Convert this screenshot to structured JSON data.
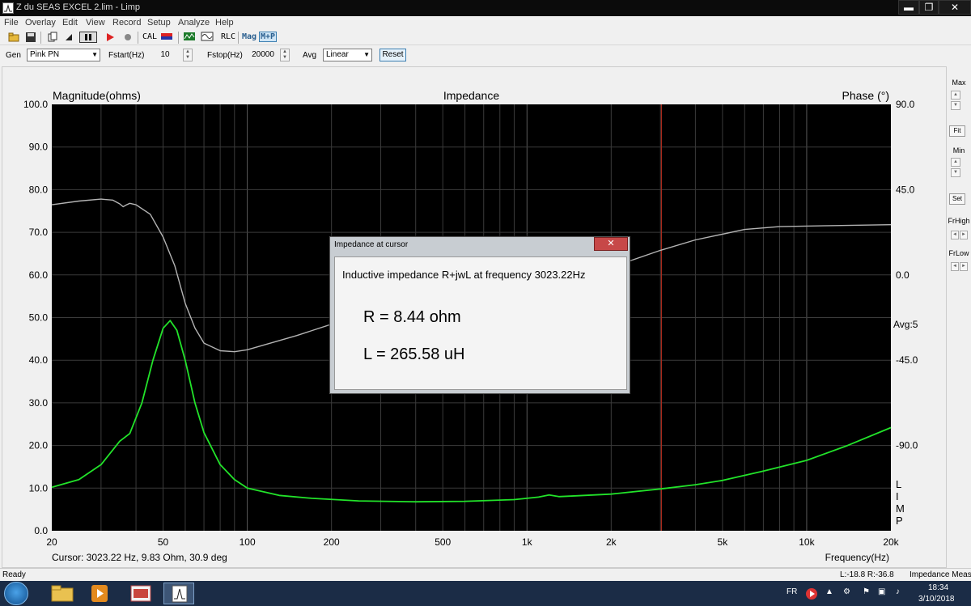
{
  "window": {
    "title": "Z du SEAS EXCEL 2.lim - Limp",
    "min_glyph": "▬",
    "max_glyph": "❐",
    "close_glyph": "✕"
  },
  "menu": [
    "File",
    "Overlay",
    "Edit",
    "View",
    "Record",
    "Setup",
    "Analyze",
    "Help"
  ],
  "toolbar": {
    "cal_label": "CAL",
    "rlc_label": "RLC",
    "mag_label": "Mag",
    "mp_label": "M+P",
    "icons": [
      "open-file-icon",
      "save-icon",
      "copy-icon",
      "play-single-icon",
      "pause-icon",
      "play-icon",
      "record-icon",
      "calibrate-icon",
      "signal-icon",
      "rlc-icon"
    ]
  },
  "controls": {
    "gen_label": "Gen",
    "gen_value": "Pink PN",
    "fstart_label": "Fstart(Hz)",
    "fstart_value": "10",
    "fstop_label": "Fstop(Hz)",
    "fstop_value": "20000",
    "avg_label": "Avg",
    "avg_value": "Linear",
    "reset_label": "Reset"
  },
  "chart_data": {
    "type": "line",
    "title": "Impedance",
    "ylabel_left": "Magnitude(ohms)",
    "ylabel_right": "Phase (°)",
    "xlabel": "Frequency(Hz)",
    "x_scale": "log",
    "xlim": [
      20,
      20000
    ],
    "ylim_left": [
      0,
      100
    ],
    "ylim_right": [
      -135,
      90
    ],
    "x_ticks": [
      {
        "v": 20,
        "label": "20"
      },
      {
        "v": 50,
        "label": "50"
      },
      {
        "v": 100,
        "label": "100"
      },
      {
        "v": 200,
        "label": "200"
      },
      {
        "v": 500,
        "label": "500"
      },
      {
        "v": 1000,
        "label": "1k"
      },
      {
        "v": 2000,
        "label": "2k"
      },
      {
        "v": 5000,
        "label": "5k"
      },
      {
        "v": 10000,
        "label": "10k"
      },
      {
        "v": 20000,
        "label": "20k"
      }
    ],
    "y_ticks_left": [
      "0.0",
      "10.0",
      "20.0",
      "30.0",
      "40.0",
      "50.0",
      "60.0",
      "70.0",
      "80.0",
      "90.0",
      "100.0"
    ],
    "y_ticks_right": [
      {
        "v": 90,
        "label": "90.0"
      },
      {
        "v": 45,
        "label": "45.0"
      },
      {
        "v": 0,
        "label": "0.0"
      },
      {
        "v": -45,
        "label": "-45.0"
      },
      {
        "v": -90,
        "label": "-90.0"
      }
    ],
    "avg_label": "Avg:5",
    "side_letters": [
      "L",
      "I",
      "M",
      "P"
    ],
    "grid": true,
    "background": "#000000",
    "cursor_x": 3023.22,
    "cursor_color": "#b02a1c",
    "series": [
      {
        "name": "Magnitude",
        "color": "#22e32a",
        "points": [
          [
            20,
            10.2
          ],
          [
            25,
            12.0
          ],
          [
            30,
            15.5
          ],
          [
            35,
            21.0
          ],
          [
            38,
            22.8
          ],
          [
            42,
            30.0
          ],
          [
            46,
            40.0
          ],
          [
            50,
            47.5
          ],
          [
            53,
            49.3
          ],
          [
            56,
            47.0
          ],
          [
            60,
            40.0
          ],
          [
            65,
            30.0
          ],
          [
            70,
            23.0
          ],
          [
            80,
            15.5
          ],
          [
            90,
            12.0
          ],
          [
            100,
            10.0
          ],
          [
            130,
            8.3
          ],
          [
            170,
            7.6
          ],
          [
            250,
            7.0
          ],
          [
            400,
            6.8
          ],
          [
            600,
            6.9
          ],
          [
            900,
            7.3
          ],
          [
            1100,
            7.9
          ],
          [
            1200,
            8.4
          ],
          [
            1300,
            8.0
          ],
          [
            1500,
            8.2
          ],
          [
            2000,
            8.6
          ],
          [
            3023,
            9.83
          ],
          [
            4000,
            10.8
          ],
          [
            5000,
            11.8
          ],
          [
            7000,
            14.0
          ],
          [
            10000,
            16.5
          ],
          [
            14000,
            20.0
          ],
          [
            20000,
            24.2
          ]
        ]
      },
      {
        "name": "Phase",
        "color": "#b4b4b4",
        "points": [
          [
            20,
            37.0
          ],
          [
            25,
            39.0
          ],
          [
            30,
            40.0
          ],
          [
            33,
            39.5
          ],
          [
            35,
            37.5
          ],
          [
            36,
            36.0
          ],
          [
            37,
            37.0
          ],
          [
            38,
            37.8
          ],
          [
            40,
            37.0
          ],
          [
            45,
            32.0
          ],
          [
            50,
            20.0
          ],
          [
            55,
            5.0
          ],
          [
            60,
            -15.0
          ],
          [
            65,
            -28.0
          ],
          [
            70,
            -36.0
          ],
          [
            80,
            -40.0
          ],
          [
            90,
            -40.5
          ],
          [
            100,
            -39.5
          ],
          [
            150,
            -32.0
          ],
          [
            200,
            -26.0
          ],
          [
            300,
            -18.0
          ],
          [
            500,
            -11.0
          ],
          [
            800,
            -5.0
          ],
          [
            1100,
            0.0
          ],
          [
            1200,
            0.5
          ],
          [
            1300,
            -1.5
          ],
          [
            1500,
            -1.0
          ],
          [
            2000,
            4.0
          ],
          [
            3000,
            13.0
          ],
          [
            4000,
            18.5
          ],
          [
            6000,
            24.0
          ],
          [
            8000,
            25.5
          ],
          [
            12000,
            26.0
          ],
          [
            20000,
            26.5
          ]
        ]
      }
    ]
  },
  "cursor_readout": "Cursor: 3023.22 Hz, 9.83 Ohm, 30.9 deg",
  "right_panel": {
    "max_label": "Max",
    "fit_label": "Fit",
    "min_label": "Min",
    "set_label": "Set",
    "frhigh_label": "FrHigh",
    "frlow_label": "FrLow"
  },
  "dialog": {
    "title": "Impedance at cursor",
    "close_glyph": "✕",
    "description": "Inductive impedance R+jwL at frequency 3023.22Hz",
    "r_text": "R = 8.44 ohm",
    "l_text": "L = 265.58 uH"
  },
  "status": {
    "left": "Ready",
    "levels": "L:-18.8  R:-36.8",
    "mode": "Impedance Measur"
  },
  "taskbar": {
    "lang": "FR",
    "time": "18:34",
    "date": "3/10/2018",
    "apps": [
      "windows-start-icon",
      "explorer-icon",
      "media-player-icon",
      "photo-app-icon",
      "limp-app-icon"
    ]
  }
}
